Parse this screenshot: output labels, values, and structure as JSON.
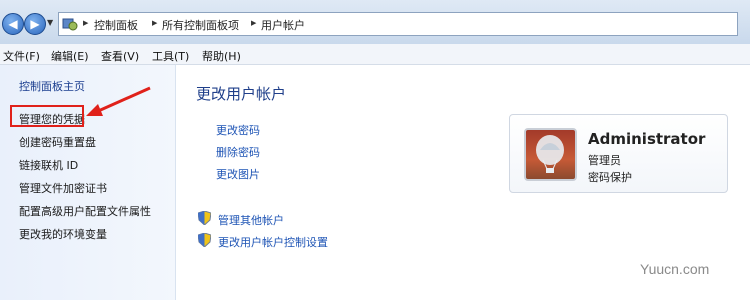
{
  "addressbar": {
    "breadcrumbs": [
      "控制面板",
      "所有控制面板项",
      "用户帐户"
    ],
    "back_icon": "back-arrow-icon",
    "forward_icon": "forward-arrow-icon"
  },
  "menubar": {
    "items": [
      "文件(F)",
      "编辑(E)",
      "查看(V)",
      "工具(T)",
      "帮助(H)"
    ]
  },
  "sidebar": {
    "items": [
      "控制面板主页",
      "管理您的凭据",
      "创建密码重置盘",
      "链接联机 ID",
      "管理文件加密证书",
      "配置高级用户配置文件属性",
      "更改我的环境变量"
    ],
    "highlighted_index": 1,
    "highlight_color": "#e0211a"
  },
  "main": {
    "title": "更改用户帐户",
    "tasks": [
      "更改密码",
      "删除密码",
      "更改图片"
    ],
    "shield_tasks": [
      "管理其他帐户",
      "更改用户帐户控制设置"
    ]
  },
  "account": {
    "name": "Administrator",
    "role": "管理员",
    "status": "密码保护"
  },
  "watermark": "Yuucn.com",
  "colors": {
    "link": "#1e54b5",
    "title": "#1f3f8a",
    "annotation": "#e0211a"
  }
}
